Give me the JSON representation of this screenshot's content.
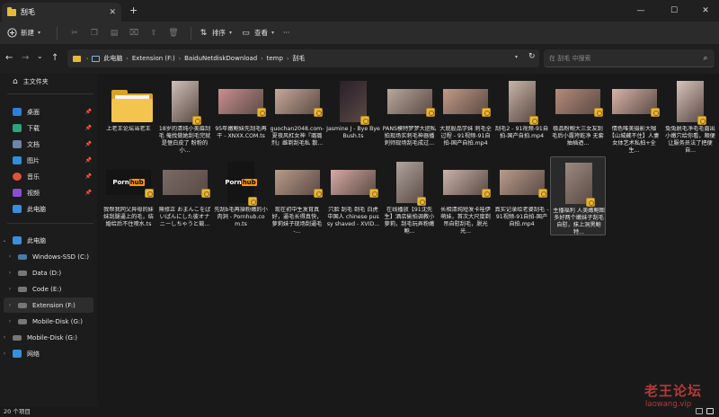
{
  "window": {
    "tab_title": "刮毛",
    "new_tab": "+",
    "minimize": "—",
    "maximize": "☐",
    "close": "✕"
  },
  "toolbar": {
    "new_label": "新建",
    "sort_label": "排序",
    "view_label": "查看",
    "more": "···"
  },
  "address": {
    "crumbs": [
      "此电脑",
      "Extension (F:)",
      "BaiduNetdiskDownload",
      "temp",
      "刮毛"
    ],
    "search_placeholder": "在 刮毛 中搜索"
  },
  "sidebar": {
    "home": "主文件夹",
    "quick": [
      {
        "label": "桌面",
        "icon": "desktop-icon",
        "color": "#2f7fd8"
      },
      {
        "label": "下载",
        "icon": "download-icon",
        "color": "#2fa37a"
      },
      {
        "label": "文档",
        "icon": "documents-icon",
        "color": "#6a86a8"
      },
      {
        "label": "图片",
        "icon": "pictures-icon",
        "color": "#2f8fd8"
      },
      {
        "label": "音乐",
        "icon": "music-icon",
        "color": "#e0533a"
      },
      {
        "label": "视频",
        "icon": "videos-icon",
        "color": "#8a4fd0"
      },
      {
        "label": "此电脑",
        "icon": "computer-icon",
        "color": "#3a8fd8"
      }
    ],
    "this_pc": "此电脑",
    "drives": [
      {
        "label": "Windows-SSD (C:)"
      },
      {
        "label": "Data (D:)"
      },
      {
        "label": "Code (E:)"
      },
      {
        "label": "Extension (F:)"
      },
      {
        "label": "Mobile-Disk (G:)"
      }
    ],
    "mobile_disk": "Mobile-Disk (G:)",
    "network": "网络"
  },
  "files": [
    {
      "name": "上老王论坛当老王",
      "kind": "folder"
    },
    {
      "name": "18岁的清纯小美眉刮毛 俺找做她刮毛完就是惬白皮了 粉粉的小...",
      "kind": "video",
      "thumb": "#cfc0b8"
    },
    {
      "name": "95年嫩鲍妹先刮毛再干 - XNXX.COM.ts",
      "kind": "video",
      "thumb": "#c98f8f"
    },
    {
      "name": "guochan2048.com-夏夜风杠女神『璐璐剂』雌剃刮毛私 散...",
      "kind": "video",
      "thumb": "#c7a89a"
    },
    {
      "name": "Jasmine J - Bye Bye Bush.ts",
      "kind": "video",
      "thumb": "#2a1f2a"
    },
    {
      "name": "PANS模特梦梦大胆私拍现场实刺毛神器播刺师现场刮毛成过...",
      "kind": "video",
      "thumb": "#b8a79c"
    },
    {
      "name": "大屁股品学妹 刺毛全过程 - 91视频-91自拍-国产自拍.mp4",
      "kind": "video",
      "thumb": "#c39a86"
    },
    {
      "name": "刮毛2 - 91视频-91自拍-国产自拍.mp4",
      "kind": "video",
      "thumb": "#c8b5a8"
    },
    {
      "name": "极品粉鲍大三女友刮毛后小露挎乾净 无套抽插迺...",
      "kind": "video",
      "thumb": "#b58a7a"
    },
    {
      "name": "情色唯美摄影大咖【山城藏不住】人妻女体艺术私拍+全生...",
      "kind": "video",
      "thumb": "#d9b4a8"
    },
    {
      "name": "兔兔脱毛净毛毛露出小嫩穴给你看，顺便让服务员法了把便自...",
      "kind": "video",
      "thumb": "#d8c4bd"
    },
    {
      "name": "我帮我同父异母的妹妹刮腿逼上的毛，结婚给后不住喷水.ts",
      "kind": "video",
      "thumb": "#141414",
      "ph": true
    },
    {
      "name": "無修正 おまんこをぱいぱんにした彼オナニーしちゃうと競...",
      "kind": "video",
      "thumb": "#7a6a66"
    },
    {
      "name": "先刮b毛再操粉嫩的小肉洞 - Pornhub.com.ts",
      "kind": "video",
      "thumb": "#141414",
      "ph": true
    },
    {
      "name": "现在初中生发育真好，逼毛长得真快，萝莉妹子现场刮逼毛 -...",
      "kind": "video",
      "thumb": "#b89b8a"
    },
    {
      "name": "穴脸 刮毛 剃毛 白虎 中国人 chinese pussy shaved - XVID...",
      "kind": "video",
      "thumb": "#d7a9a4"
    },
    {
      "name": "在线播放【91沈先生】酒店偷拍调教小萝莉，刮毛玩弄粉嫩鲍...",
      "kind": "video",
      "thumb": "#b0a49e"
    },
    {
      "name": "长相清纯短发卡哇伊萌妹，首次大尺度剃吊自慰刮毛，脱光光...",
      "kind": "video",
      "thumb": "#c9b3aa"
    },
    {
      "name": "真实记录给老婆刮毛 - 91视频-91自拍-国产自拍.mp4",
      "kind": "video",
      "thumb": "#b99c8c"
    },
    {
      "name": "主播福利 人美嫩鲍图多好两个嫩妹子刮毛自慰，抹上洞黑鲍特...",
      "kind": "video",
      "thumb": "#9c8a80",
      "selected": true
    }
  ],
  "status": {
    "count": "20 个项目"
  },
  "watermark": {
    "title": "老王论坛",
    "url": "laowang.vip"
  }
}
